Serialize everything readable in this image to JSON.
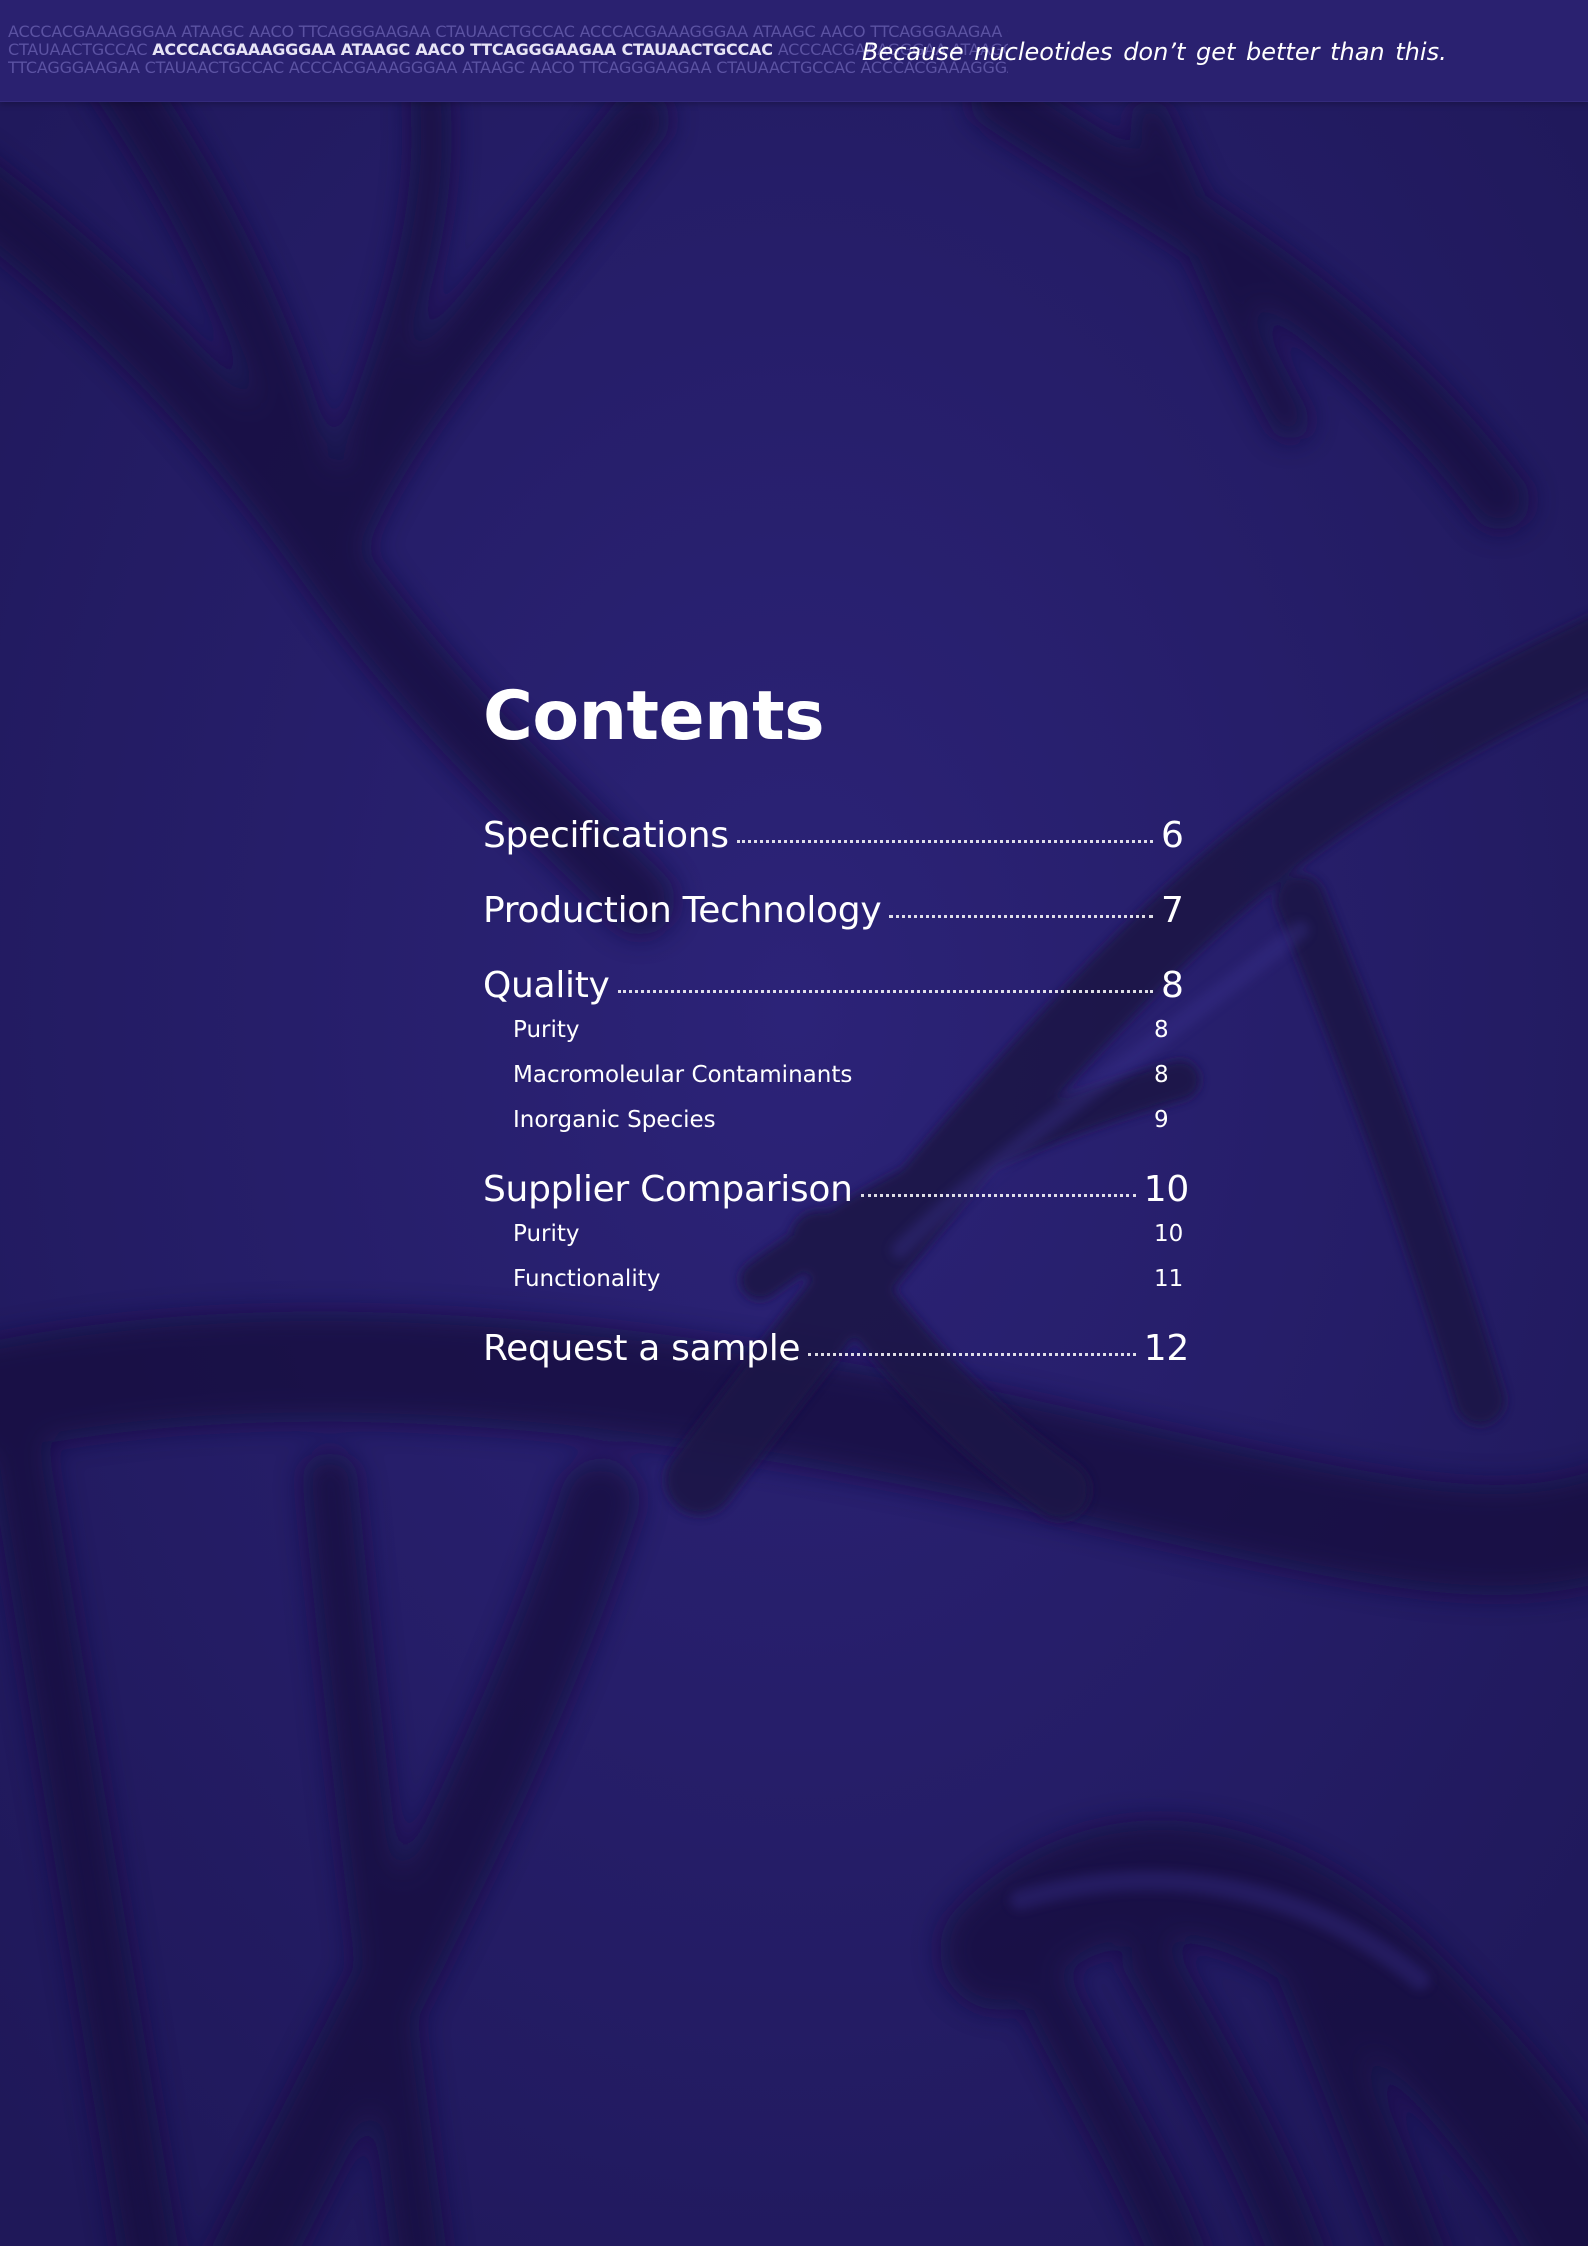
{
  "header": {
    "sequence_lines": [
      {
        "pre": "ACCCACGAAAGGGAA  ATAAGC  AACO  TTCAGGGAAGAA  CTAUAACTGCCAC  ACCCACGAAAGGGAA  ATAAGC  AACO  TTCAGGGAAGAA  CTAUAACTGCCAC",
        "bold": "",
        "post": ""
      },
      {
        "pre": "CTAUAACTGCCAC ",
        "bold": "ACCCACGAAAGGGAA ATAAGC AACO TTCAGGGAAGAA CTAUAACTGCCAC",
        "post": " ACCCACGAAAGGGAA ATAAGC AACO TTCAGGGAAGAA"
      },
      {
        "pre": "TTCAGGGAAGAA  CTAUAACTGCCAC  ACCCACGAAAGGGAA  ATAAGC  AACO  TTCAGGGAAGAA  CTAUAACTGCCAC  ACCCACGAAAGGGAA  ATAAGC",
        "bold": "",
        "post": ""
      }
    ],
    "tagline": "Because  nucleotides  don’t get better  than this."
  },
  "contents": {
    "title": "Contents",
    "entries": [
      {
        "label": "Specifications",
        "page": "6",
        "subs": []
      },
      {
        "label": "Production Technology",
        "page": "7",
        "subs": []
      },
      {
        "label": "Quality",
        "page": "8",
        "subs": [
          {
            "label": "Purity",
            "page": "8"
          },
          {
            "label": "Macromoleular Contaminants",
            "page": "8"
          },
          {
            "label": "Inorganic Species",
            "page": "9"
          }
        ]
      },
      {
        "label": "Supplier Comparison",
        "page": "10",
        "subs": [
          {
            "label": "Purity",
            "page": "10"
          },
          {
            "label": "Functionality",
            "page": "11"
          }
        ]
      },
      {
        "label": "Request a sample",
        "page": "12",
        "subs": []
      }
    ]
  },
  "colors": {
    "background": "#241c66",
    "header_bar": "#2a2170",
    "text": "#ffffff"
  }
}
